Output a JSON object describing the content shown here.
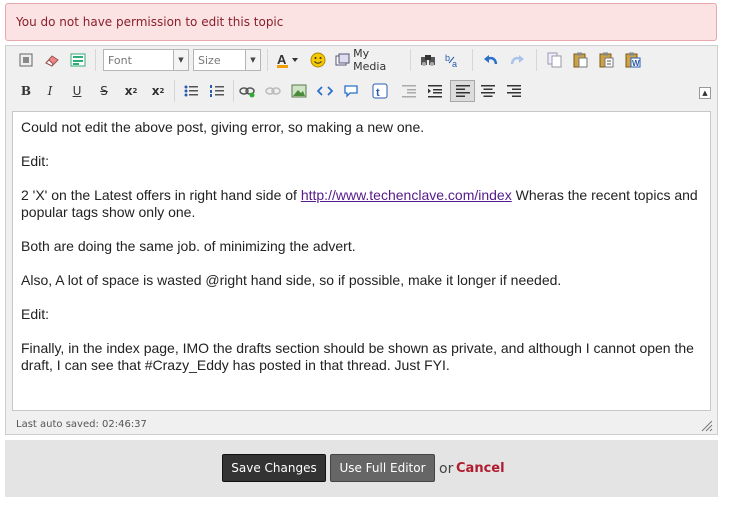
{
  "alert": {
    "message": "You do not have permission to edit this topic"
  },
  "toolbar": {
    "font_label": "Font",
    "size_label": "Size",
    "my_media_label": "My Media",
    "icons_row1": [
      "source-icon",
      "eraser-icon",
      "template-icon",
      "font-color-icon",
      "emoticon-icon",
      "my-media-icon",
      "find-icon",
      "replace-icon",
      "undo-icon",
      "redo-icon",
      "copy-icon",
      "paste-icon",
      "paste-text-icon",
      "paste-word-icon"
    ],
    "icons_row2": [
      "bold",
      "italic",
      "underline",
      "strikethrough",
      "subscript",
      "superscript",
      "bulleted-list",
      "numbered-list",
      "link",
      "unlink",
      "image",
      "code",
      "quote",
      "twitter",
      "outdent",
      "indent",
      "align-left",
      "align-center",
      "align-right"
    ],
    "bold_label": "B",
    "italic_label": "I",
    "underline_label": "U",
    "strike_label": "S",
    "sub_label": "x",
    "sub_mark": "2",
    "sup_label": "x",
    "sup_mark": "2",
    "active_alignment": "left"
  },
  "content": {
    "p1": "Could not edit the above post, giving error, so making a new one.",
    "p2": "Edit:",
    "p3_before": "2 'X' on the Latest offers in right hand side of ",
    "p3_link": "http://www.techenclave.com/index",
    "p3_after": " Wheras the recent topics and popular tags show only one.",
    "p4": "Both are doing the same job. of minimizing the advert.",
    "p5": "Also, A lot of space is wasted @right hand side, so if possible, make it longer if needed.",
    "p6": "Edit:",
    "p7": "Finally, in the index page, IMO the drafts section should be shown as private, and although I cannot open the draft, I can see that #Crazy_Eddy has posted in that thread. Just FYI."
  },
  "status": {
    "autosave": "Last auto saved: 02:46:37"
  },
  "footer": {
    "save_label": "Save Changes",
    "full_editor_label": "Use Full Editor",
    "or_label": "or",
    "cancel_label": "Cancel"
  }
}
